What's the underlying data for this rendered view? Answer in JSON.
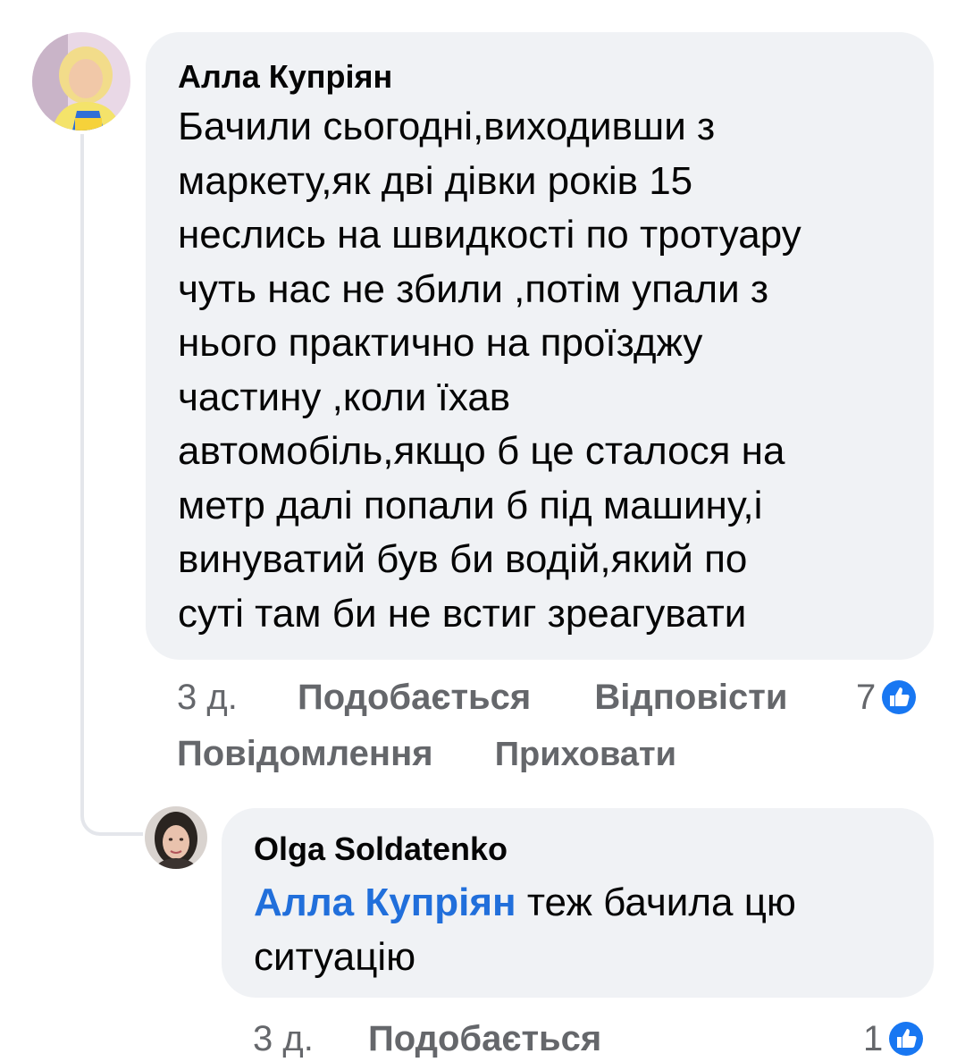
{
  "comments": [
    {
      "author": "Алла Купріян",
      "text_lines": [
        "Бачили сьогодні,виходивши з",
        "маркету,як дві дівки років 15",
        "неслись на швидкості по тротуару",
        "чуть нас не збили ,потім упали з",
        "нього практично на проїзджу",
        "частину ,коли їхав",
        "автомобіль,якщо б це сталося на",
        "метр далі попали б під машину,і",
        "винуватий був би водій,який по",
        "суті там би не встиг зреагувати"
      ],
      "time": "3 д.",
      "like_label": "Подобається",
      "reply_label": "Відповісти",
      "report_label": "Повідомлення",
      "hide_label": "Приховати",
      "reaction_count": "7",
      "avatar_icon": "user-avatar-photo"
    },
    {
      "author": "Olga Soldatenko",
      "mention": "Алла Купріян",
      "text_line1": " теж бачила цю",
      "text_line2": "ситуацію",
      "time": "3 д.",
      "like_label": "Подобається",
      "reaction_count": "1",
      "avatar_icon": "user-avatar-photo"
    }
  ],
  "colors": {
    "bubble": "#f0f2f5",
    "mention": "#216fdb",
    "like_blue": "#1877f2",
    "meta_gray": "#65676b"
  },
  "icons": {
    "reaction": "like-thumb-icon"
  }
}
